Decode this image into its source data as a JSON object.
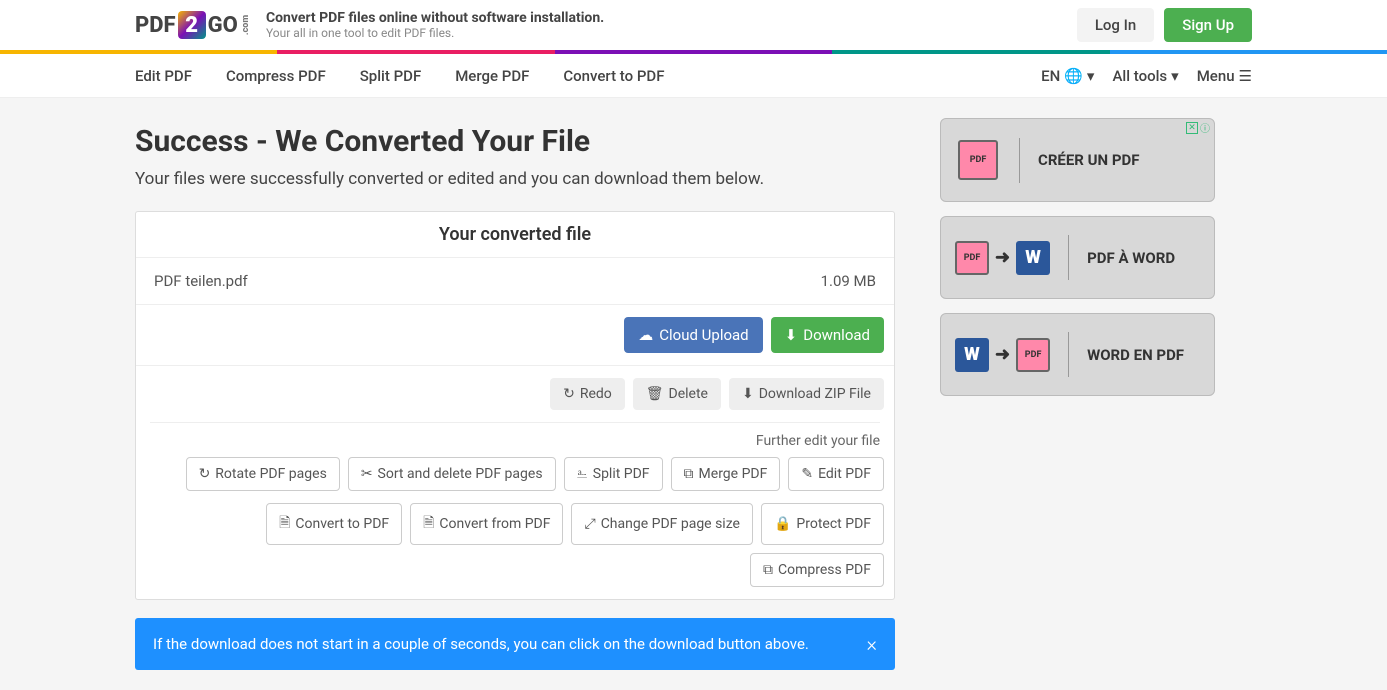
{
  "header": {
    "logo_pdf": "PDF",
    "logo_2": "2",
    "logo_go": "GO",
    "logo_com": ".com",
    "tagline_title": "Convert PDF files online without software installation.",
    "tagline_sub": "Your all in one tool to edit PDF files.",
    "login": "Log In",
    "signup": "Sign Up"
  },
  "nav": {
    "edit_pdf": "Edit PDF",
    "compress_pdf": "Compress PDF",
    "split_pdf": "Split PDF",
    "merge_pdf": "Merge PDF",
    "convert_to_pdf": "Convert to PDF",
    "lang": "EN",
    "all_tools": "All tools",
    "menu": "Menu"
  },
  "page": {
    "title": "Success - We Converted Your File",
    "subtitle": "Your files were successfully converted or edited and you can download them below."
  },
  "panel": {
    "header": "Your converted file",
    "filename": "PDF teilen.pdf",
    "filesize": "1.09 MB",
    "cloud_upload": "Cloud Upload",
    "download": "Download",
    "redo": "Redo",
    "delete": "Delete",
    "download_zip": "Download ZIP File",
    "further_edit": "Further edit your file",
    "rotate": "Rotate PDF pages",
    "sort_delete": "Sort and delete PDF pages",
    "split": "Split PDF",
    "merge": "Merge PDF",
    "edit": "Edit PDF",
    "convert_to": "Convert to PDF",
    "convert_from": "Convert from PDF",
    "change_size": "Change PDF page size",
    "protect": "Protect PDF",
    "compress": "Compress PDF"
  },
  "alert": {
    "text": "If the download does not start in a couple of seconds, you can click on the download button above.",
    "close": "×"
  },
  "ads": {
    "ad1_text": "CRÉER UN PDF",
    "ad2_text": "PDF À WORD",
    "ad3_text": "WORD EN PDF",
    "pdf_label": "PDF",
    "word_label": "W",
    "arrow": "➜",
    "badge_x": "✕",
    "badge_i": "ⓘ"
  }
}
